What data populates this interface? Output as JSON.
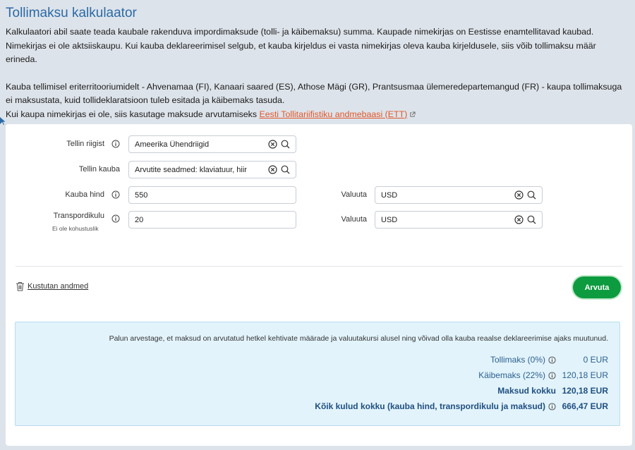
{
  "page": {
    "title": "Tollimaksu kalkulaator",
    "intro_p1": "Kalkulaatori abil saate teada kaubale rakenduva impordimaksude (tolli- ja käibemaksu) summa. Kaupade nimekirjas on Eestisse enamtellitavad kaubad. Nimekirjas ei ole aktsiiskaupu. Kui kauba deklareerimisel selgub, et kauba kirjeldus ei vasta nimekirjas oleva kauba kirjeldusele, siis võib tollimaksu määr erineda.",
    "intro_p2": "Kauba tellimisel eriterritooriumidelt - Ahvenamaa (FI), Kanaari saared (ES), Athose Mägi (GR), Prantsusmaa ülemeredepartemangud (FR) - kaupa tollimaksuga ei maksustata, kuid tollideklaratsioon tuleb esitada ja käibemaks tasuda.",
    "intro_p3_prefix": "Kui kaupa nimekirjas ei ole, siis kasutage maksude arvutamiseks",
    "intro_link": "Eesti Tollitariifistiku andmebaasi (ETT)"
  },
  "form": {
    "country_label": "Tellin riigist",
    "country_value": "Ameerika Ühendriigid",
    "goods_label": "Tellin kauba",
    "goods_value": "Arvutite seadmed: klaviatuur, hiir",
    "price_label": "Kauba hind",
    "price_value": "550",
    "currency_label": "Valuuta",
    "currency_value": "USD",
    "transport_label": "Transpordikulu",
    "transport_sublabel": "Ei ole kohustuslik",
    "transport_value": "20",
    "transport_currency_label": "Valuuta",
    "transport_currency_value": "USD"
  },
  "actions": {
    "clear_label": "Kustutan andmed",
    "calculate_label": "Arvuta"
  },
  "results": {
    "notice": "Palun arvestage, et maksud on arvutatud hetkel kehtivate määrade ja valuutakursi alusel ning võivad olla kauba reaalse deklareerimise ajaks muutunud.",
    "customs_label": "Tollimaks (0%)",
    "customs_value": "0 EUR",
    "vat_label": "Käibemaks (22%)",
    "vat_value": "120,18 EUR",
    "taxes_total_label": "Maksud kokku",
    "taxes_total_value": "120,18 EUR",
    "grand_total_label": "Kõik kulud kokku (kauba hind, transpordikulu ja maksud)",
    "grand_total_value": "666,47 EUR"
  },
  "colors": {
    "title": "#2b6aa6",
    "link": "#e0582a",
    "button": "#0d9b3f",
    "results_bg": "#e2f3fb"
  }
}
